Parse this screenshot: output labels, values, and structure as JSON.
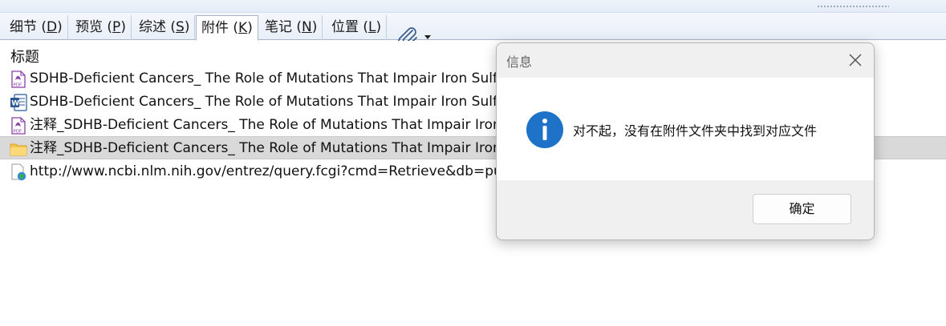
{
  "tabs": [
    {
      "label_main": "细节 (",
      "key": "D",
      "label_end": ")"
    },
    {
      "label_main": "预览 (",
      "key": "P",
      "label_end": ")"
    },
    {
      "label_main": "综述 (",
      "key": "S",
      "label_end": ")"
    },
    {
      "label_main": "附件 (",
      "key": "K",
      "label_end": ")"
    },
    {
      "label_main": "笔记 (",
      "key": "N",
      "label_end": ")"
    },
    {
      "label_main": "位置 (",
      "key": "L",
      "label_end": ")"
    }
  ],
  "list": {
    "header": "标题",
    "rows": [
      {
        "icon": "pdf-icon",
        "text": "SDHB-Deficient Cancers_ The Role of Mutations That Impair Iron Sulfur Cluster Delivery"
      },
      {
        "icon": "word-doc-icon",
        "text": "SDHB-Deficient Cancers_ The Role of Mutations That Impair Iron Sulfur Cluster Delivery"
      },
      {
        "icon": "pdf-icon",
        "text": "注释_SDHB-Deficient Cancers_ The Role of Mutations That Impair Iron Sulfur Cluster Delivery"
      },
      {
        "icon": "folder-icon",
        "text": "注释_SDHB-Deficient Cancers_ The Role of Mutations That Impair Iron Sulfur Cluster Delivery"
      },
      {
        "icon": "web-link-icon",
        "text": "http://www.ncbi.nlm.nih.gov/entrez/query.fcgi?cmd=Retrieve&db=pubmed"
      }
    ]
  },
  "dialog": {
    "title": "信息",
    "message": "对不起，没有在附件文件夹中找到对应文件",
    "ok_label": "确定"
  },
  "colors": {
    "info_blue": "#1e73c8",
    "pdf_purple": "#8a3ea8",
    "word_blue": "#2b5797",
    "folder_yellow": "#f4c64e",
    "selection_gray": "#d9d9d9"
  }
}
